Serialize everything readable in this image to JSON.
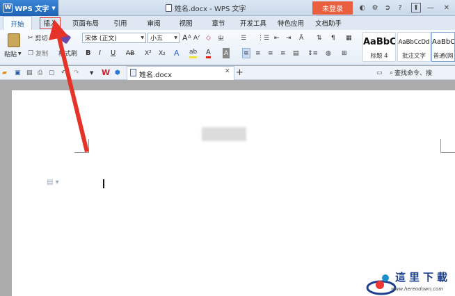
{
  "app": {
    "menu_label": "WPS 文字",
    "title": "姓名.docx - WPS 文字",
    "login": "未登录"
  },
  "tabs": [
    "开始",
    "插入",
    "页面布局",
    "引用",
    "审阅",
    "视图",
    "章节",
    "开发工具",
    "特色应用",
    "文档助手"
  ],
  "ribbon": {
    "paste": "粘贴",
    "cut": "剪切",
    "copy": "复制",
    "format_painter": "格式刷",
    "font_name": "宋体 (正文)",
    "font_size": "小五",
    "styles": [
      {
        "sample": "AaBbC",
        "name": "标题 4"
      },
      {
        "sample": "AaBbCcDd",
        "name": "批注文字"
      },
      {
        "sample": "AaBbC",
        "name": "普通(网"
      }
    ]
  },
  "doc_tab": {
    "name": "姓名.docx"
  },
  "search": {
    "label": "查找命令、搜"
  },
  "watermark": {
    "text": "這里下載",
    "url": "www.hereodown.com"
  }
}
